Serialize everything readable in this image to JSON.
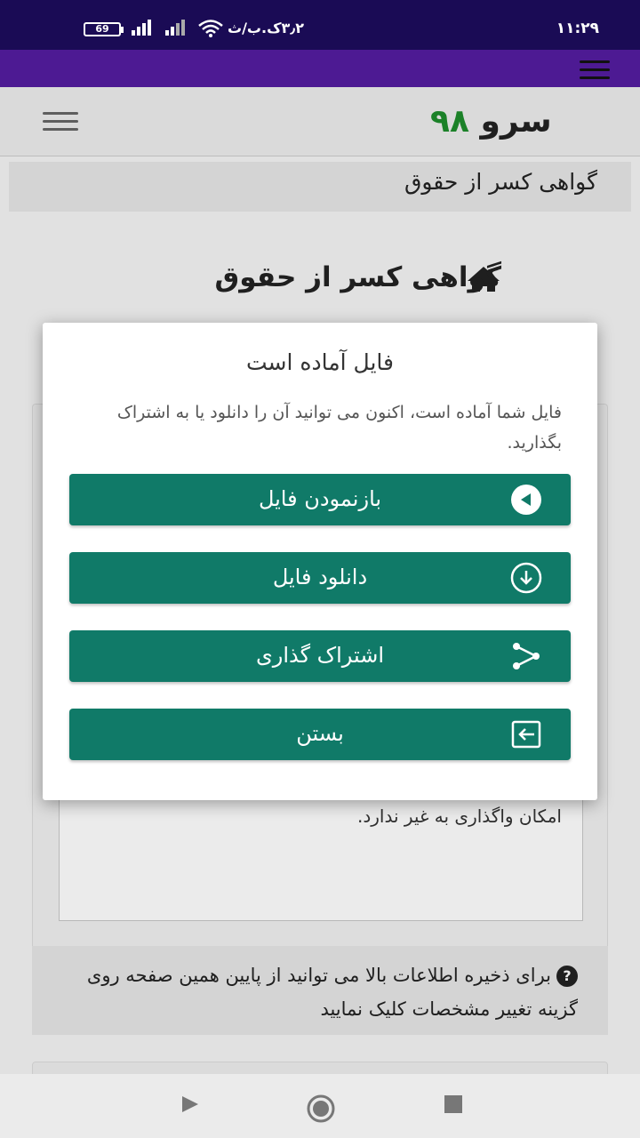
{
  "status_bar": {
    "time": "۱۱:۲۹",
    "network_speed": "۳٫۲ک.ب/ث",
    "battery": "69"
  },
  "header": {
    "brand_name": "سرو",
    "brand_number": "۹۸"
  },
  "breadcrumb": "گواهی کسر از حقوق",
  "page_title": "گواهی کسر از حقوق",
  "card_text": "امکان واگذاری به غیر ندارد.",
  "help_text": "برای ذخیره اطلاعات بالا می توانید از پایین همین صفحه روی گزینه تغییر مشخصات کلیک نمایید",
  "modal": {
    "title": "فایل آماده است",
    "body": "فایل شما آماده است، اکنون می توانید آن را دانلود یا به اشتراک بگذارید.",
    "buttons": {
      "open": "بازنمودن فایل",
      "download": "دانلود فایل",
      "share": "اشتراک گذاری",
      "close": "بستن"
    }
  },
  "colors": {
    "status_bar": "#1a0b55",
    "app_bar": "#4d1a93",
    "button": "#107a68",
    "brand_number": "#1e8c2c"
  },
  "icons": [
    "home-icon",
    "hamburger-icon",
    "play-icon",
    "download-icon",
    "share-icon",
    "exit-icon",
    "help-icon"
  ]
}
